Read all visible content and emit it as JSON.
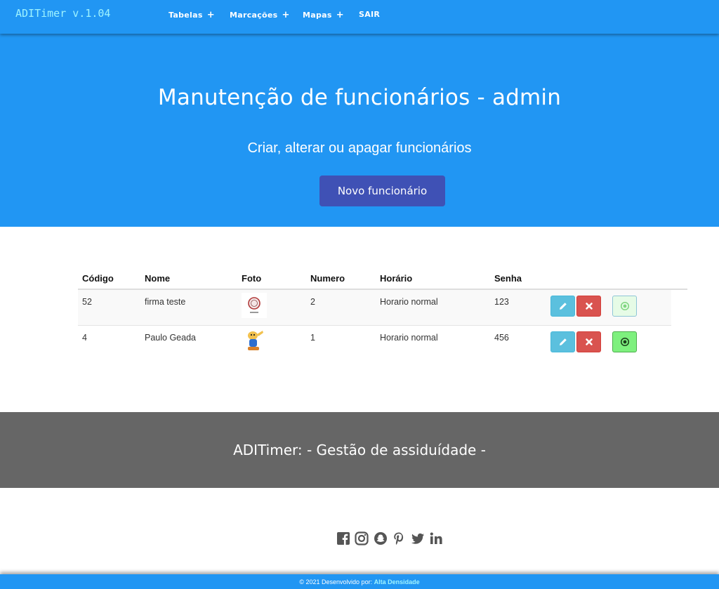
{
  "navbar": {
    "brand": "ADITimer v.1.04",
    "items": [
      {
        "label": "Tabelas",
        "plus": "+"
      },
      {
        "label": "Marcações",
        "plus": "+"
      },
      {
        "label": "Mapas",
        "plus": "+"
      },
      {
        "label": "SAIR",
        "plus": ""
      }
    ]
  },
  "hero": {
    "title": "Manutenção de funcionários - admin",
    "subtitle": "Criar, alterar ou apagar funcionários",
    "new_button": "Novo funcionário"
  },
  "table": {
    "columns": [
      "Código",
      "Nome",
      "Foto",
      "Numero",
      "Horário",
      "Senha",
      ""
    ],
    "rows": [
      {
        "codigo": "52",
        "nome": "firma teste",
        "numero": "2",
        "horario": "Horario normal",
        "senha": "123",
        "active": false
      },
      {
        "codigo": "4",
        "nome": "Paulo Geada",
        "numero": "1",
        "horario": "Horario normal",
        "senha": "456",
        "active": true
      }
    ]
  },
  "footer": {
    "title": "ADITimer: - Gestão de assiduídade -",
    "social_icons": [
      "facebook-icon",
      "instagram-icon",
      "snapchat-icon",
      "pinterest-icon",
      "twitter-icon",
      "linkedin-icon"
    ],
    "copyright_prefix": "© 2021 Desenvolvido por:",
    "developer": "Alta Densidade"
  },
  "colors": {
    "primary": "#2196f3",
    "brand_text": "#9ef3ff",
    "new_button": "#3f51b5",
    "footer_band": "#666666",
    "edit_button": "#5bc0de",
    "delete_button": "#d9534f",
    "activate_button": "#7ef07e"
  }
}
